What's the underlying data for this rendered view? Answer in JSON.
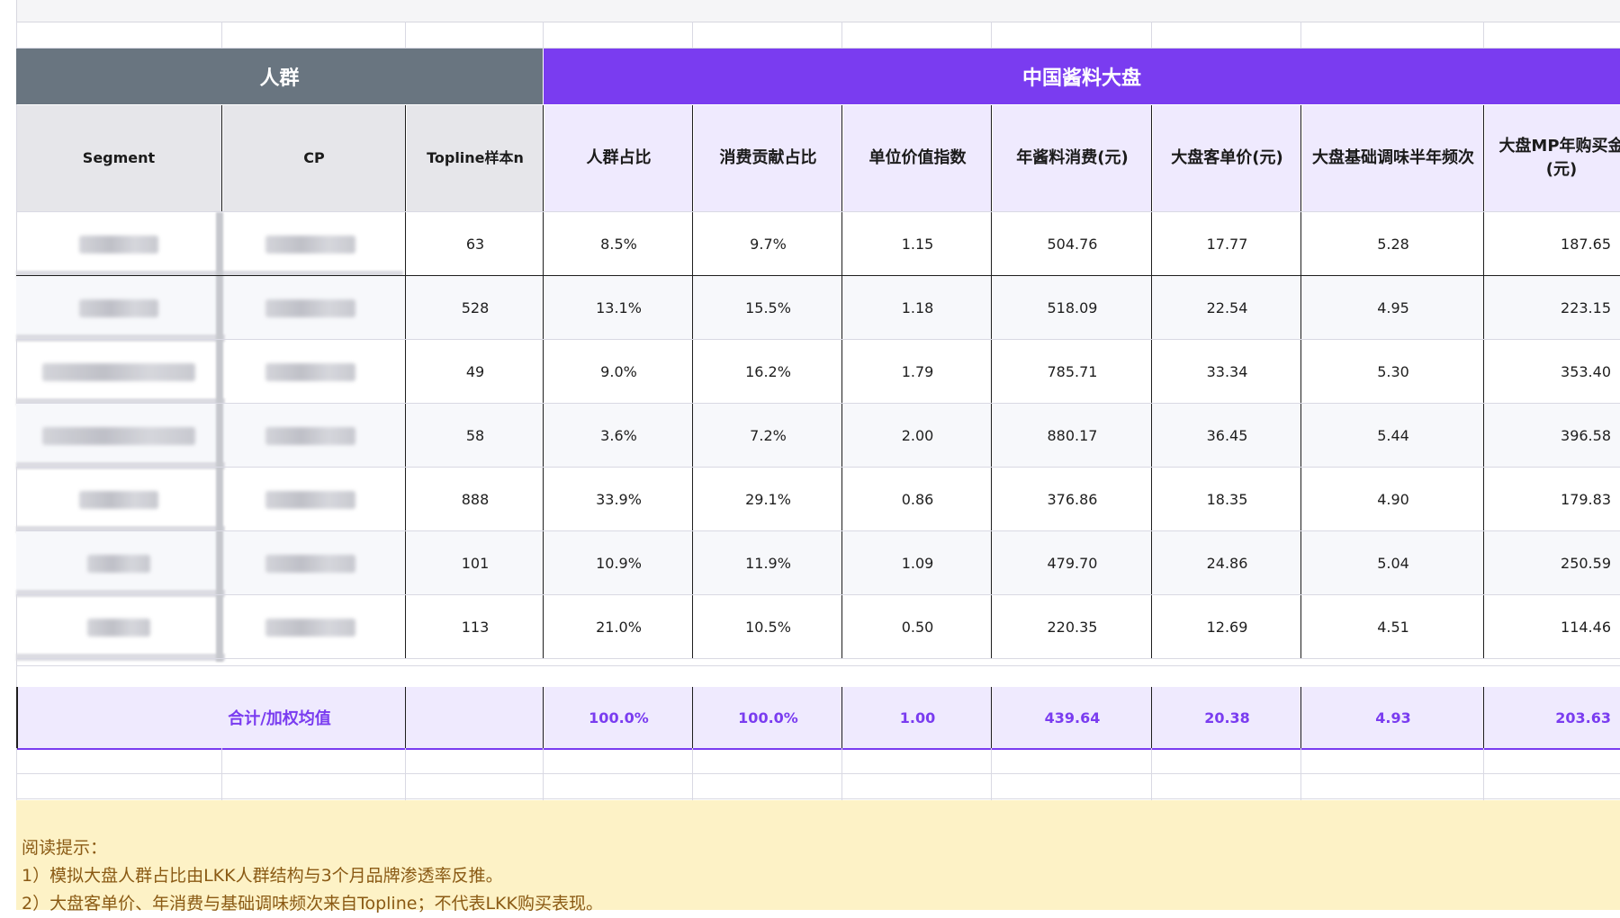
{
  "table": {
    "group_headers": {
      "people": "人群",
      "market": "中国酱料大盘"
    },
    "columns": {
      "segment": "Segment",
      "cp": "CP",
      "topline_n": "Topline样本n",
      "pop_share": "人群占比",
      "spend_share": "消费贡献占比",
      "unit_value_index": "单位价值指数",
      "annual_spend": "年酱料消费(元)",
      "avg_price": "大盘客单价(元)",
      "base_freq": "大盘基础调味半年频次",
      "mp_annual_amount": "大盘MP年购买金 (元)"
    },
    "rows": [
      {
        "topline_n": "63",
        "pop_share": "8.5%",
        "spend_share": "9.7%",
        "unit_value_index": "1.15",
        "annual_spend": "504.76",
        "avg_price": "17.77",
        "base_freq": "5.28",
        "mp_annual_amount": "187.65"
      },
      {
        "topline_n": "528",
        "pop_share": "13.1%",
        "spend_share": "15.5%",
        "unit_value_index": "1.18",
        "annual_spend": "518.09",
        "avg_price": "22.54",
        "base_freq": "4.95",
        "mp_annual_amount": "223.15"
      },
      {
        "topline_n": "49",
        "pop_share": "9.0%",
        "spend_share": "16.2%",
        "unit_value_index": "1.79",
        "annual_spend": "785.71",
        "avg_price": "33.34",
        "base_freq": "5.30",
        "mp_annual_amount": "353.40"
      },
      {
        "topline_n": "58",
        "pop_share": "3.6%",
        "spend_share": "7.2%",
        "unit_value_index": "2.00",
        "annual_spend": "880.17",
        "avg_price": "36.45",
        "base_freq": "5.44",
        "mp_annual_amount": "396.58"
      },
      {
        "topline_n": "888",
        "pop_share": "33.9%",
        "spend_share": "29.1%",
        "unit_value_index": "0.86",
        "annual_spend": "376.86",
        "avg_price": "18.35",
        "base_freq": "4.90",
        "mp_annual_amount": "179.83"
      },
      {
        "topline_n": "101",
        "pop_share": "10.9%",
        "spend_share": "11.9%",
        "unit_value_index": "1.09",
        "annual_spend": "479.70",
        "avg_price": "24.86",
        "base_freq": "5.04",
        "mp_annual_amount": "250.59"
      },
      {
        "topline_n": "113",
        "pop_share": "21.0%",
        "spend_share": "10.5%",
        "unit_value_index": "0.50",
        "annual_spend": "220.35",
        "avg_price": "12.69",
        "base_freq": "4.51",
        "mp_annual_amount": "114.46"
      }
    ],
    "total": {
      "label": "合计/加权均值",
      "pop_share": "100.0%",
      "spend_share": "100.0%",
      "unit_value_index": "1.00",
      "annual_spend": "439.64",
      "avg_price": "20.38",
      "base_freq": "4.93",
      "mp_annual_amount": "203.63"
    }
  },
  "note": {
    "title": "阅读提示：",
    "lines": [
      "1）模拟大盘人群占比由LKK人群结构与3个月品牌渗透率反推。",
      "2）大盘客单价、年消费与基础调味频次来自Topline；不代表LKK购买表现。"
    ]
  },
  "colors": {
    "people_header": "#697580",
    "market_header": "#7a3cf0",
    "market_subheader": "#efeafe",
    "total_text": "#7a3cf0",
    "note_bg": "#fdf2c6",
    "note_text": "#8a5a14"
  }
}
